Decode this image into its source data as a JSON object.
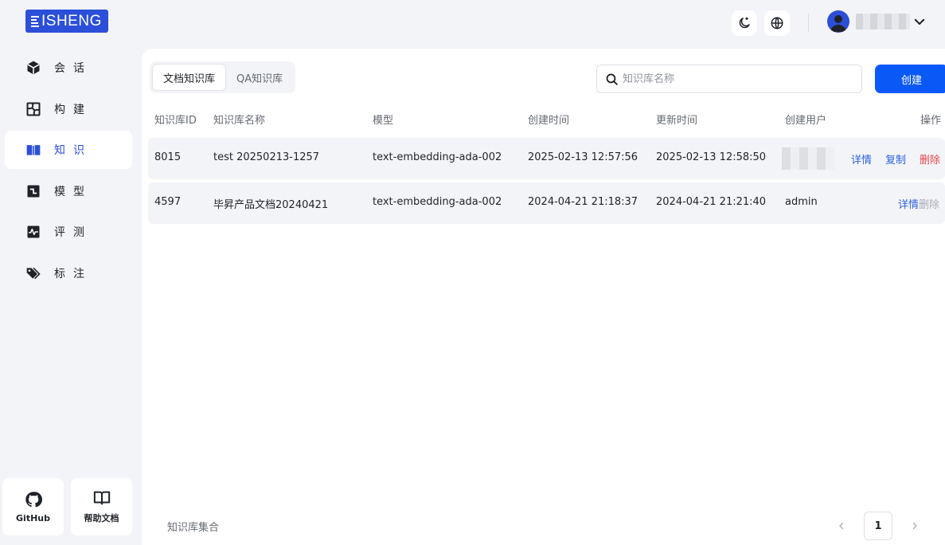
{
  "brand": {
    "logo_text": "ISHENG"
  },
  "header": {
    "theme_icon": "moon-icon",
    "language_icon": "globe-icon",
    "user_icon": "user-avatar-icon"
  },
  "sidebar": {
    "items": [
      {
        "label": "会话",
        "icon": "cube-icon",
        "active": false
      },
      {
        "label": "构建",
        "icon": "build-icon",
        "active": false
      },
      {
        "label": "知识",
        "icon": "book-open-icon",
        "active": true
      },
      {
        "label": "模型",
        "icon": "model-icon",
        "active": false
      },
      {
        "label": "评测",
        "icon": "pulse-icon",
        "active": false
      },
      {
        "label": "标注",
        "icon": "tag-icon",
        "active": false
      }
    ],
    "footer": [
      {
        "label": "GitHub",
        "icon": "github-icon"
      },
      {
        "label": "帮助文档",
        "icon": "book-icon"
      }
    ]
  },
  "main": {
    "tabs": [
      {
        "label": "文档知识库",
        "active": true
      },
      {
        "label": "QA知识库",
        "active": false
      }
    ],
    "search": {
      "placeholder": "知识库名称",
      "value": ""
    },
    "create_label": "创建",
    "table": {
      "columns": [
        "知识库ID",
        "知识库名称",
        "模型",
        "创建时间",
        "更新时间",
        "创建用户",
        "操作"
      ],
      "rows": [
        {
          "id": "8015",
          "name": "test 20250213-1257",
          "model": "text-embedding-ada-002",
          "created": "2025-02-13 12:57:56",
          "updated": "2025-02-13 12:58:50",
          "user": "",
          "actions": [
            "详情",
            "复制",
            "删除"
          ]
        },
        {
          "id": "4597",
          "name": "毕昇产品文档20240421",
          "model": "text-embedding-ada-002",
          "created": "2024-04-21 21:18:37",
          "updated": "2024-04-21 21:21:40",
          "user": "admin",
          "actions": [
            "详情",
            "删除"
          ]
        }
      ]
    },
    "footer_label": "知识库集合",
    "pagination": {
      "current": "1"
    }
  },
  "colors": {
    "accent": "#0a59f7",
    "brand": "#2b4fd8",
    "danger": "#e5484d"
  }
}
